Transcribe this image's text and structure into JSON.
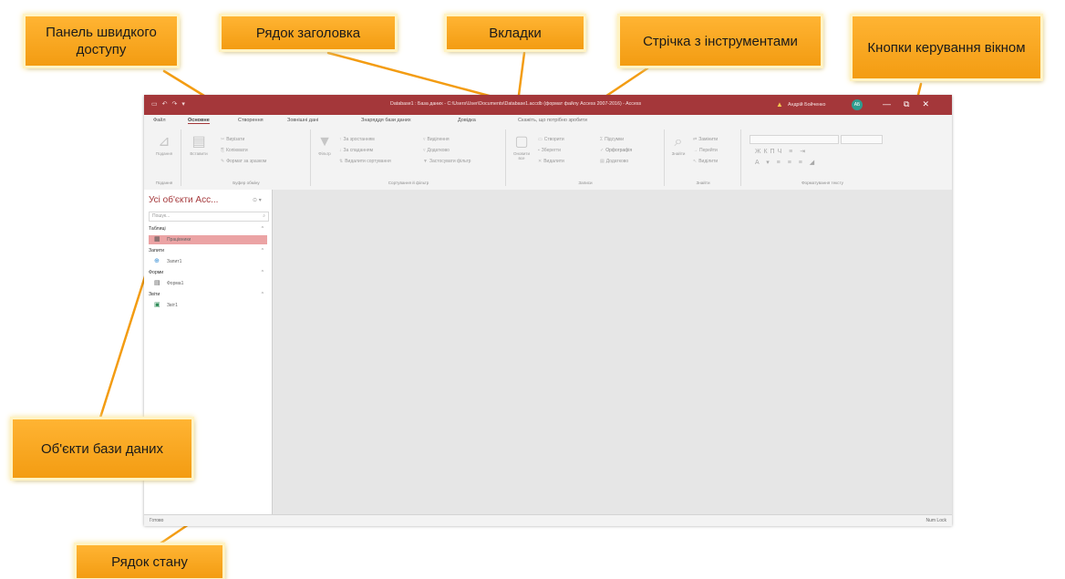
{
  "callouts": {
    "qat": "Панель швидкого доступу",
    "title": "Рядок заголовка",
    "tabs": "Вкладки",
    "ribbon": "Стрічка з інструментами",
    "window_buttons": "Кнопки керування вікном",
    "objects": "Об'єкти бази даних",
    "status": "Рядок стану"
  },
  "titlebar": {
    "qat_icons": [
      "▭",
      "↶",
      "↷",
      "▾"
    ],
    "title": "Database1 : База даних - C:\\Users\\User\\Documents\\Database1.accdb (формат файлу Access 2007-2016) - Access",
    "user": "Андрій Бойченко",
    "avatar": "АБ",
    "warn": "▲",
    "min": "—",
    "max": "⧉",
    "close": "✕"
  },
  "tabs": {
    "items": [
      "Файл",
      "Основне",
      "Створення",
      "Зовнішні дані",
      "Знаряддя бази даних",
      "Довідка"
    ],
    "tell": "Скажіть, що потрібно зробити"
  },
  "ribbon": {
    "groups": [
      {
        "label": "Подання"
      },
      {
        "label": "Буфер обміну"
      },
      {
        "label": "Сортування й фільтр"
      },
      {
        "label": "Записи"
      },
      {
        "label": "Знайти"
      },
      {
        "label": "Форматування тексту"
      }
    ],
    "view_btn": "Подання",
    "paste_btn": "Вставити",
    "filter_btn": "Фільтр",
    "refresh_btn": "Оновити все",
    "find_btn": "Знайти",
    "cut": "Вирізати",
    "copy": "Копіювати",
    "painter": "Формат за зразком",
    "asc": "За зростанням",
    "desc": "За спаданням",
    "remove_sort": "Видалити сортування",
    "selection": "Виділення",
    "advanced": "Додатково",
    "toggle_filter": "Застосувати фільтр",
    "new": "Створити",
    "save": "Зберегти",
    "delete": "Видалити",
    "totals": "Підсумки",
    "spelling": "Орфографія",
    "more": "Додатково",
    "replace": "Замінити",
    "goto": "Перейти",
    "select": "Виділити"
  },
  "nav": {
    "title": "Усі об'єкти Acc...",
    "controls": "⊙ ▾",
    "search_placeholder": "Пошук...",
    "search_icon": "⌕",
    "sections": [
      {
        "label": "Таблиці",
        "items": [
          "Працівники"
        ]
      },
      {
        "label": "Запити",
        "items": [
          "Запит1"
        ]
      },
      {
        "label": "Форми",
        "items": [
          "Форма1"
        ]
      },
      {
        "label": "Звіти",
        "items": [
          "Звіт1"
        ]
      }
    ],
    "chevron": "^"
  },
  "status": {
    "left": "Готово",
    "right": "Num Lock"
  }
}
